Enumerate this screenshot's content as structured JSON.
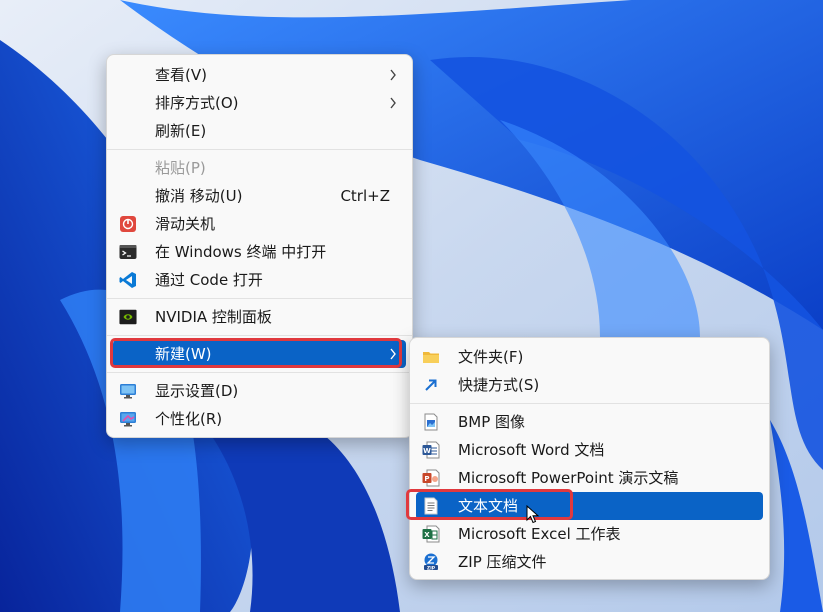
{
  "main_menu": {
    "items": [
      {
        "label": "查看(V)"
      },
      {
        "label": "排序方式(O)"
      },
      {
        "label": "刷新(E)"
      },
      {
        "label": "粘贴(P)"
      },
      {
        "label": "撤消 移动(U)",
        "shortcut": "Ctrl+Z"
      },
      {
        "label": "滑动关机",
        "icon": "power-slide-icon"
      },
      {
        "label": "在 Windows 终端 中打开",
        "icon": "terminal-icon"
      },
      {
        "label": "通过 Code 打开",
        "icon": "vscode-icon"
      },
      {
        "label": "NVIDIA 控制面板",
        "icon": "nvidia-icon"
      },
      {
        "label": "新建(W)"
      },
      {
        "label": "显示设置(D)",
        "icon": "display-icon"
      },
      {
        "label": "个性化(R)",
        "icon": "personalize-icon"
      }
    ]
  },
  "sub_menu": {
    "items": [
      {
        "label": "文件夹(F)",
        "icon": "folder-icon"
      },
      {
        "label": "快捷方式(S)",
        "icon": "shortcut-arrow-icon"
      },
      {
        "label": "BMP 图像",
        "icon": "bmp-image-icon"
      },
      {
        "label": "Microsoft Word 文档",
        "icon": "word-icon"
      },
      {
        "label": "Microsoft PowerPoint 演示文稿",
        "icon": "powerpoint-icon"
      },
      {
        "label": "文本文档",
        "icon": "text-document-icon"
      },
      {
        "label": "Microsoft Excel 工作表",
        "icon": "excel-icon"
      },
      {
        "label": "ZIP 压缩文件",
        "icon": "zip-icon"
      }
    ]
  },
  "colors": {
    "selection": "#0a63c6",
    "highlight_outline": "#e0393e",
    "menu_bg": "#f9f9f9"
  }
}
